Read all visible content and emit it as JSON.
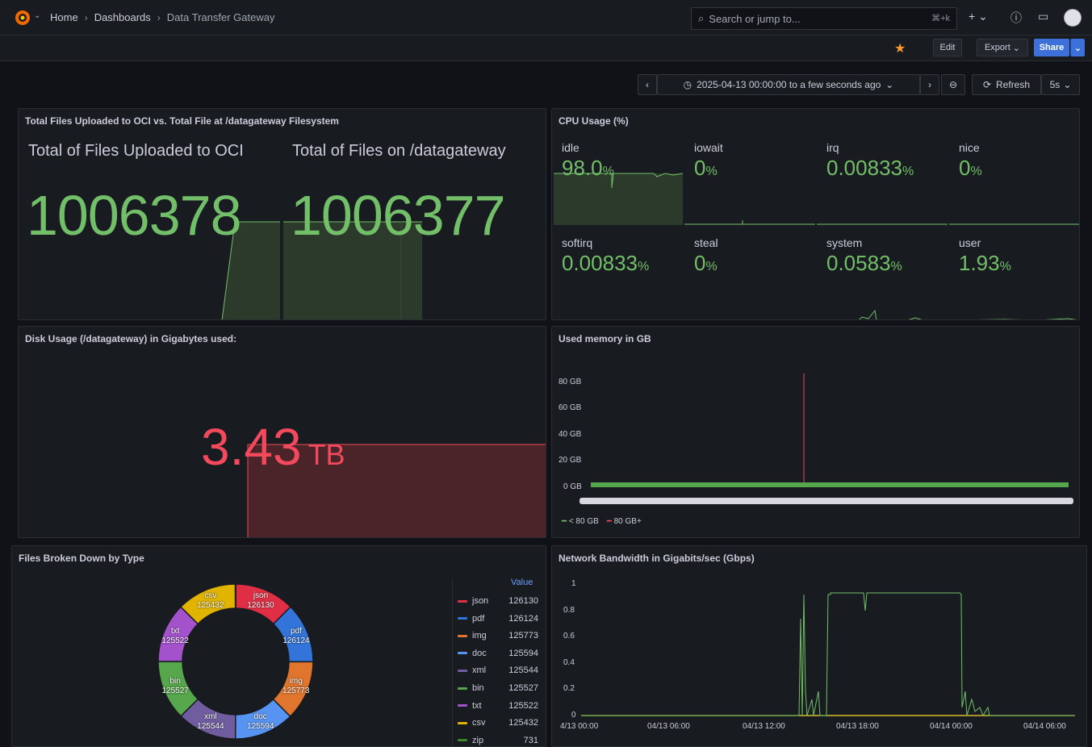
{
  "breadcrumbs": [
    "Home",
    "Dashboards",
    "Data Transfer Gateway"
  ],
  "search": {
    "placeholder": "Search or jump to...",
    "shortcut": "⌘+k"
  },
  "toolbar": {
    "edit": "Edit",
    "export": "Export",
    "share": "Share"
  },
  "timepicker": {
    "range": "2025-04-13 00:00:00 to a few seconds ago",
    "refresh": "Refresh",
    "interval": "5s"
  },
  "panels": {
    "files": {
      "title": "Total Files Uploaded to OCI vs. Total File at /datagateway Filesystem",
      "uploaded_label": "Total of Files Uploaded to OCI",
      "uploaded_value": "1006378",
      "onfs_label": "Total of Files on /datagateway",
      "onfs_value": "1006377"
    },
    "cpu": {
      "title": "CPU Usage (%)",
      "cells": [
        {
          "label": "idle",
          "value": "98.0",
          "unit": "%"
        },
        {
          "label": "iowait",
          "value": "0",
          "unit": "%"
        },
        {
          "label": "irq",
          "value": "0.00833",
          "unit": "%"
        },
        {
          "label": "nice",
          "value": "0",
          "unit": "%"
        },
        {
          "label": "softirq",
          "value": "0.00833",
          "unit": "%"
        },
        {
          "label": "steal",
          "value": "0",
          "unit": "%"
        },
        {
          "label": "system",
          "value": "0.0583",
          "unit": "%"
        },
        {
          "label": "user",
          "value": "1.93",
          "unit": "%"
        }
      ]
    },
    "disk": {
      "title": "Disk Usage (/datagateway) in Gigabytes used:",
      "value": "3.43",
      "unit": "TB"
    },
    "memory": {
      "title": "Used memory in GB",
      "yticks": [
        "80 GB",
        "60 GB",
        "40 GB",
        "20 GB",
        "0 GB"
      ],
      "legend": [
        {
          "label": "< 80 GB",
          "color": "#73bf69"
        },
        {
          "label": "80 GB+",
          "color": "#f2495c"
        }
      ]
    },
    "types": {
      "title": "Files Broken Down by Type",
      "value_header": "Value",
      "items": [
        {
          "name": "json",
          "value": "126130",
          "color": "#e02f44"
        },
        {
          "name": "pdf",
          "value": "126124",
          "color": "#3274d9"
        },
        {
          "name": "img",
          "value": "125773",
          "color": "#e0752d"
        },
        {
          "name": "doc",
          "value": "125594",
          "color": "#5794f2"
        },
        {
          "name": "xml",
          "value": "125544",
          "color": "#705da0"
        },
        {
          "name": "bin",
          "value": "125527",
          "color": "#56a64b"
        },
        {
          "name": "txt",
          "value": "125522",
          "color": "#a352cc"
        },
        {
          "name": "csv",
          "value": "125432",
          "color": "#e0b400"
        },
        {
          "name": "zip",
          "value": "731",
          "color": "#37872d"
        }
      ]
    },
    "network": {
      "title": "Network Bandwidth in Gigabits/sec (Gbps)",
      "yticks": [
        "1",
        "0.8",
        "0.6",
        "0.4",
        "0.2",
        "0"
      ],
      "xticks": [
        "4/13 00:00",
        "04/13 06:00",
        "04/13 12:00",
        "04/13 18:00",
        "04/14 00:00",
        "04/14 06:00"
      ]
    }
  }
}
